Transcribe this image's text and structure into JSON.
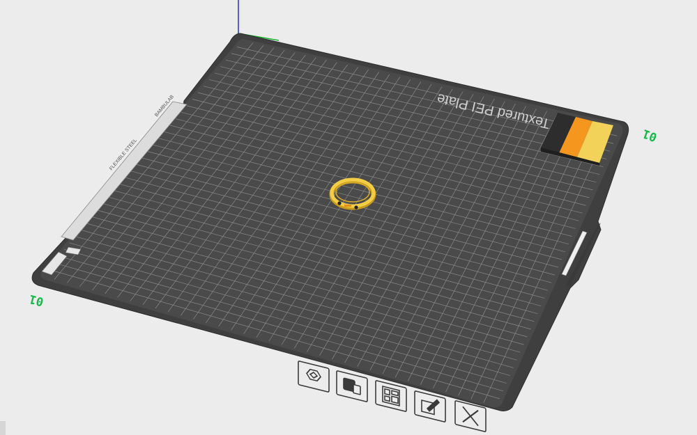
{
  "scene": {
    "plate_name": "Textured PEI Plate",
    "plate_number_front": "01",
    "plate_number_right": "01",
    "side_tab_text": "BAMBULAB",
    "side_tab_small": "FLEXIBLE STEEL",
    "bed_color": "#4a4a4a",
    "object": "ring",
    "filament_colors": [
      "#2d2d2d",
      "#f5961e",
      "#f3d25a"
    ]
  },
  "plate_toolbar": {
    "buttons": [
      {
        "name": "auto-orient-button",
        "icon": "hexagon-icon"
      },
      {
        "name": "lock-plate-button",
        "icon": "lock-icon"
      },
      {
        "name": "arrange-button",
        "icon": "arrange-icon"
      },
      {
        "name": "plate-settings-button",
        "icon": "edit-icon"
      },
      {
        "name": "delete-plate-button",
        "icon": "close-icon"
      }
    ]
  }
}
